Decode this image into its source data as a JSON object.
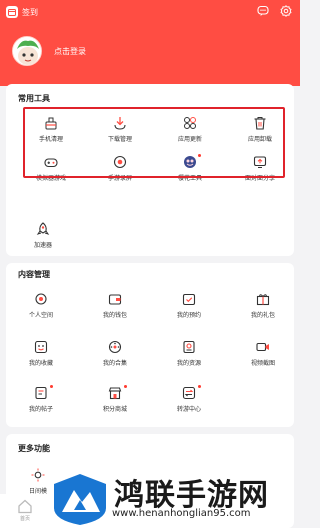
{
  "header": {
    "sign_label": "签到",
    "login_label": "点击登录",
    "accent": "#ff4d43",
    "icons": [
      "message-icon",
      "settings-icon"
    ]
  },
  "common_tools": {
    "title": "常用工具",
    "items": [
      {
        "label": "手机清理",
        "icon": "broom-icon"
      },
      {
        "label": "下载管理",
        "icon": "download-icon"
      },
      {
        "label": "应用更新",
        "icon": "apps-update-icon"
      },
      {
        "label": "应用卸载",
        "icon": "trash-icon"
      },
      {
        "label": "模拟器游戏",
        "icon": "gamepad-icon"
      },
      {
        "label": "手游录屏",
        "icon": "screen-record-icon"
      },
      {
        "label": "樱花工具",
        "icon": "sakura-tool-icon"
      },
      {
        "label": "面对面分享",
        "icon": "share-icon"
      },
      {
        "label": "加速器",
        "icon": "rocket-icon"
      }
    ]
  },
  "content_mgmt": {
    "title": "内容管理",
    "items": [
      {
        "label": "个人空间",
        "icon": "planet-icon"
      },
      {
        "label": "我的钱包",
        "icon": "wallet-icon"
      },
      {
        "label": "我的预约",
        "icon": "calendar-check-icon"
      },
      {
        "label": "我的礼包",
        "icon": "gift-icon"
      },
      {
        "label": "我的收藏",
        "icon": "favorite-icon"
      },
      {
        "label": "我的合集",
        "icon": "collection-icon"
      },
      {
        "label": "我的资源",
        "icon": "resource-icon"
      },
      {
        "label": "视频截图",
        "icon": "video-icon"
      },
      {
        "label": "我的帖子",
        "icon": "post-icon"
      },
      {
        "label": "积分商城",
        "icon": "shop-icon"
      },
      {
        "label": "转游中心",
        "icon": "transfer-icon"
      }
    ]
  },
  "more": {
    "title": "更多功能",
    "items": [
      {
        "label": "日间模",
        "icon": "sun-icon"
      }
    ]
  },
  "bottom_nav": {
    "home_label": "首页"
  },
  "watermark": {
    "title": "鸿联手游网",
    "url": "www.henanhonglian95.com"
  }
}
